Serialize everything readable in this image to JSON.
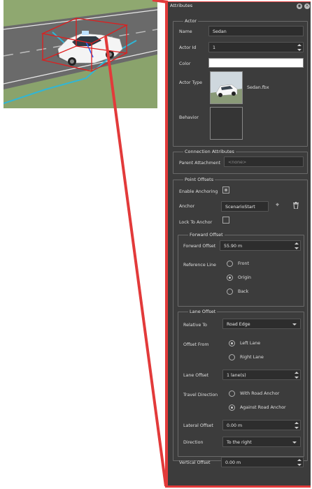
{
  "panel": {
    "title": "Attributes"
  },
  "actor": {
    "group_title": "Actor",
    "name_label": "Name",
    "name_value": "Sedan",
    "id_label": "Actor Id",
    "id_value": "1",
    "color_label": "Color",
    "color_value": "#ffffff",
    "type_label": "Actor Type",
    "type_value": "Sedan.fbx",
    "behavior_label": "Behavior"
  },
  "connection": {
    "group_title": "Connection Attributes",
    "parent_label": "Parent Attachment",
    "parent_value": "<none>"
  },
  "point_offsets": {
    "group_title": "Point Offsets",
    "enable_anchoring_label": "Enable Anchoring",
    "enable_anchoring_checked": true,
    "anchor_label": "Anchor",
    "anchor_value": "ScenarioStart",
    "lock_label": "Lock To Anchor",
    "lock_checked": false
  },
  "forward_offset": {
    "group_title": "Forward Offset",
    "offset_label": "Forward Offset",
    "offset_value": "55.90 m",
    "ref_label": "Reference Line",
    "options": [
      "Front",
      "Origin",
      "Back"
    ],
    "selected": "Origin"
  },
  "lane_offset": {
    "group_title": "Lane Offset",
    "relative_label": "Relative To",
    "relative_value": "Road Edge",
    "offset_from_label": "Offset From",
    "offset_from_options": [
      "Left Lane",
      "Right Lane"
    ],
    "offset_from_selected": "Left Lane",
    "lane_offset_label": "Lane Offset",
    "lane_offset_value": "1 lane(s)",
    "travel_label": "Travel Direction",
    "travel_options": [
      "With Road Anchor",
      "Against Road Anchor"
    ],
    "travel_selected": "Against Road Anchor",
    "lateral_label": "Lateral Offset",
    "lateral_value": "0.00 m",
    "direction_label": "Direction",
    "direction_value": "To the right"
  },
  "vertical": {
    "label": "Vertical Offset",
    "value": "0.00 m"
  },
  "colors": {
    "callout": "#e23a3a",
    "panel_bg": "#3c3c3c",
    "field_bg": "#2d2d2d"
  }
}
